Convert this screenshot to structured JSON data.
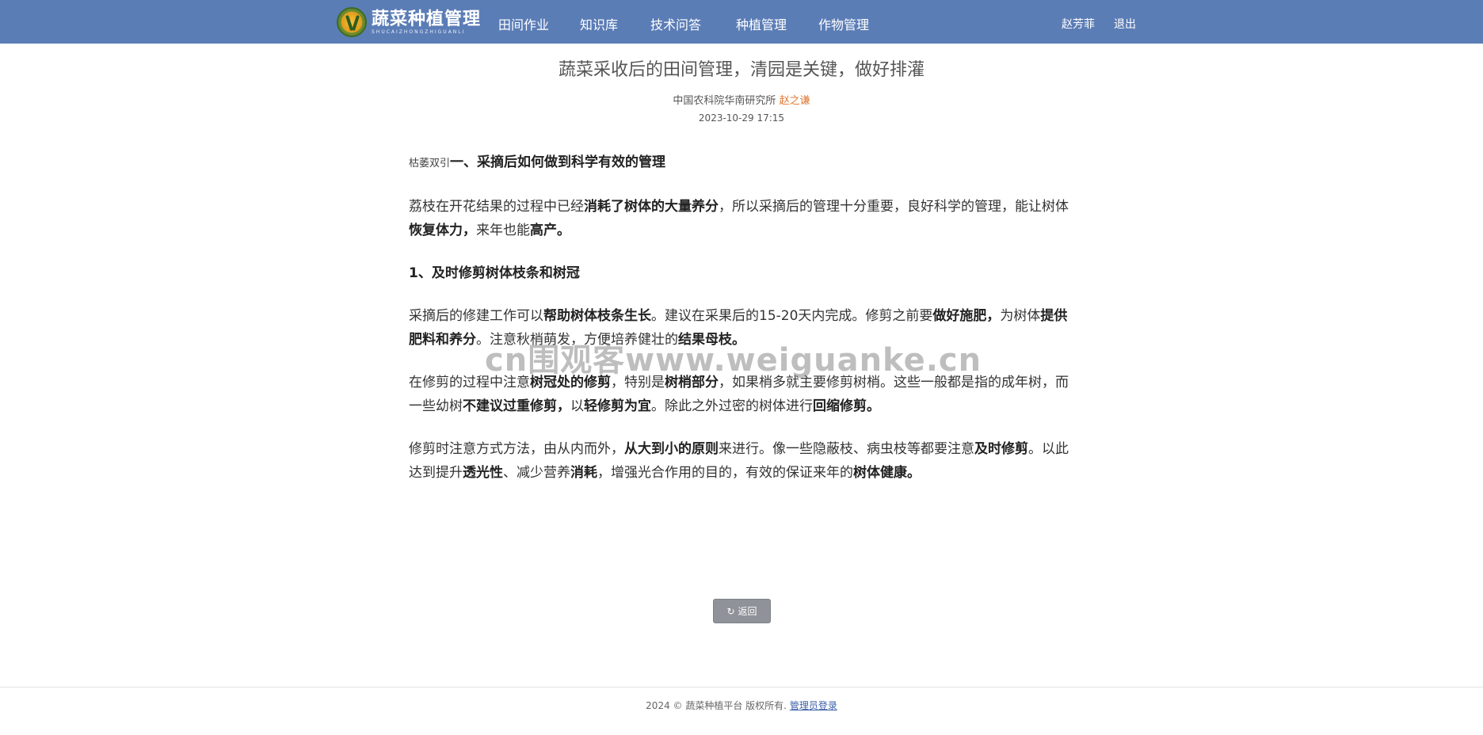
{
  "header": {
    "logo_title": "蔬菜种植管理",
    "logo_subtitle": "SHUCAIZHONGZHIGUANLI",
    "nav": [
      "田间作业",
      "知识库",
      "技术问答",
      "种植管理",
      "作物管理"
    ],
    "user_name": "赵芳菲",
    "logout_label": "退出",
    "brand_color": "#5b7db6"
  },
  "article": {
    "title": "蔬菜采收后的田间管理，清园是关键，做好排灌",
    "source": "中国农科院华南研究所",
    "author": "赵之谦",
    "date": "2023-10-29 17:15",
    "p1_prefix": "枯萎双引",
    "p1_bold": "一、采摘后如何做到科学有效的管理",
    "p2": [
      "荔枝在开花结果的过程中已经",
      "消耗了树体的大量养分",
      "，所以采摘后的管理十分重要，良好科学的管理，能让树体",
      "恢复体力，",
      "来年也能",
      "高产。"
    ],
    "p3_bold": "1、及时修剪树体枝条和树冠",
    "p4": [
      "采摘后的修建工作可以",
      "帮助树体枝条生长",
      "。建议在采果后的15-20天内完成。修剪之前要",
      "做好施肥，",
      "为树体",
      "提供肥料和养分",
      "。注意秋梢萌发，方便培养健壮的",
      "结果母枝。"
    ],
    "p5": [
      "在修剪的过程中注意",
      "树冠处的修剪",
      "，特别是",
      "树梢部分",
      "，如果梢多就主要修剪树梢。这些一般都是指的成年树，而一些幼树",
      "不建议过重修剪，",
      "以",
      "轻修剪为宜",
      "。除此之外过密的树体进行",
      "回缩修剪。"
    ],
    "p6": [
      "修剪时注意方式方法，由从内而外，",
      "从大到小的原则",
      "来进行。像一些隐蔽枝、病虫枝等都要注意",
      "及时修剪",
      "。以此达到提升",
      "透光性",
      "、减少营养",
      "消耗",
      "，增强光合作用的目的，有效的保证来年的",
      "树体健康。"
    ]
  },
  "watermark": "cn围观客www.weiguanke.cn",
  "back_button": {
    "icon": "refresh-icon",
    "label": "返回"
  },
  "footer": {
    "copyright": "2024 © 蔬菜种植平台 版权所有.",
    "admin_link": "管理员登录"
  }
}
